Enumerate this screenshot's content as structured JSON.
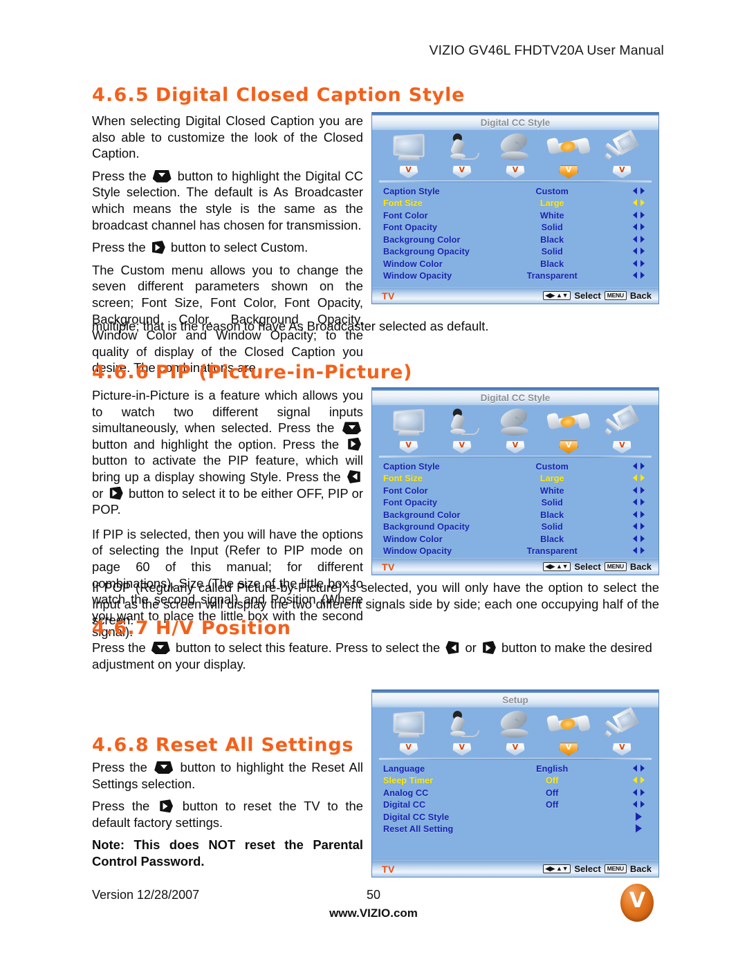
{
  "header": {
    "title": "VIZIO GV46L FHDTV20A User Manual"
  },
  "sections": [
    {
      "number": "4.6.5",
      "title": "Digital Closed Caption Style",
      "paragraphs": [
        "When selecting Digital Closed Caption you are also able to customize the look of the Closed Caption.",
        "Press the ",
        " button to highlight the Digital CC Style selection.  The default is As Broadcaster which means the style is the same as the broadcast channel has chosen for transmission.",
        "Press the ",
        " button to select Custom.",
        "The Custom menu allows you to change the seven different parameters shown on the screen; Font Size, Font Color, Font Opacity, Background Color, Background Opacity, Window Color and Window Opacity; to the quality of display of the Closed Caption you desire. The combinations are",
        "multiple; that is the reason to have As Broadcaster selected as default."
      ]
    },
    {
      "number": "4.6.6",
      "title": "PIP (Picture-in-Picture)",
      "paragraphs": [
        "Picture-in-Picture is a feature which allows you to watch two different signal inputs simultaneously, when selected. Press the ",
        " button and highlight the option. Press the ",
        " button to activate the PIP feature, which will bring up a display showing Style. Press the ",
        " or ",
        " button to select it to be either OFF, PIP or POP.",
        "If PIP is selected, then you will have the options of selecting the Input (Refer to PIP mode on page 60 of this manual; for different combinations), Size (The size of the little box to watch the second signal) and Position (Where you want to place the little box with the second signal).",
        "If POP (Regularly called Picture-by-Picture) is selected, you will only have the option to select the Input as the screen will display the two different signals side by side; each one occupying half of the screen."
      ]
    },
    {
      "number": "4.6.7",
      "title": "H/V Position",
      "paragraphs": [
        "Press the ",
        " button to select this feature. Press to select the ",
        " or ",
        " button to make the desired adjustment on your display."
      ]
    },
    {
      "number": "4.6.8",
      "title": "Reset All Settings",
      "paragraphs": [
        "Press the ",
        " button to highlight the Reset All Settings selection.",
        "Press the ",
        " button to reset the TV to the default factory settings.",
        "Note: This does NOT reset the Parental Control Password."
      ]
    }
  ],
  "osd_panels": [
    {
      "title": "Digital CC Style",
      "active_icon_index": 3,
      "icons": [
        "monitor-icon",
        "microphone-icon",
        "satellite-dish-icon",
        "wrench-icon",
        "key-icon"
      ],
      "tab_letter": "V",
      "rows": [
        {
          "label": "Caption Style",
          "value": "Custom",
          "arrow": "left-right",
          "highlighted": false
        },
        {
          "label": "Font Size",
          "value": "Large",
          "arrow": "left-right",
          "highlighted": true
        },
        {
          "label": "Font Color",
          "value": "White",
          "arrow": "left-right",
          "highlighted": false
        },
        {
          "label": "Font Opacity",
          "value": "Solid",
          "arrow": "left-right",
          "highlighted": false
        },
        {
          "label": "Backgroung Color",
          "value": "Black",
          "arrow": "left-right",
          "highlighted": false
        },
        {
          "label": "Backgroung Opacity",
          "value": "Solid",
          "arrow": "left-right",
          "highlighted": false
        },
        {
          "label": "Window Color",
          "value": "Black",
          "arrow": "left-right",
          "highlighted": false
        },
        {
          "label": "Window Opacity",
          "value": "Transparent",
          "arrow": "left-right",
          "highlighted": false
        }
      ],
      "footer": {
        "source": "TV",
        "select_label": "Select",
        "menu_key": "MENU",
        "back_label": "Back"
      }
    },
    {
      "title": "Digital CC Style",
      "active_icon_index": 3,
      "icons": [
        "monitor-icon",
        "microphone-icon",
        "satellite-dish-icon",
        "wrench-icon",
        "key-icon"
      ],
      "tab_letter": "V",
      "rows": [
        {
          "label": "Caption Style",
          "value": "Custom",
          "arrow": "left-right",
          "highlighted": false
        },
        {
          "label": "Font Size",
          "value": "Large",
          "arrow": "left-right",
          "highlighted": true
        },
        {
          "label": "Font Color",
          "value": "White",
          "arrow": "left-right",
          "highlighted": false
        },
        {
          "label": "Font Opacity",
          "value": "Solid",
          "arrow": "left-right",
          "highlighted": false
        },
        {
          "label": "Background Color",
          "value": "Black",
          "arrow": "left-right",
          "highlighted": false
        },
        {
          "label": "Background Opacity",
          "value": "Solid",
          "arrow": "left-right",
          "highlighted": false
        },
        {
          "label": "Window Color",
          "value": "Black",
          "arrow": "left-right",
          "highlighted": false
        },
        {
          "label": "Window Opacity",
          "value": "Transparent",
          "arrow": "left-right",
          "highlighted": false
        }
      ],
      "footer": {
        "source": "TV",
        "select_label": "Select",
        "menu_key": "MENU",
        "back_label": "Back"
      }
    },
    {
      "title": "Setup",
      "active_icon_index": 3,
      "icons": [
        "monitor-icon",
        "microphone-icon",
        "satellite-dish-icon",
        "wrench-icon",
        "key-icon"
      ],
      "tab_letter": "V",
      "rows": [
        {
          "label": "Language",
          "value": "English",
          "arrow": "left-right",
          "highlighted": false
        },
        {
          "label": "Sleep Timer",
          "value": "Off",
          "arrow": "left-right",
          "highlighted": true
        },
        {
          "label": "Analog CC",
          "value": "Off",
          "arrow": "left-right",
          "highlighted": false
        },
        {
          "label": "Digital  CC",
          "value": "Off",
          "arrow": "left-right",
          "highlighted": false
        },
        {
          "label": "Digital  CC  Style",
          "value": "",
          "arrow": "right",
          "highlighted": false
        },
        {
          "label": "Reset  All  Setting",
          "value": "",
          "arrow": "right",
          "highlighted": false
        }
      ],
      "footer": {
        "source": "TV",
        "select_label": "Select",
        "menu_key": "MENU",
        "back_label": "Back"
      }
    }
  ],
  "footer": {
    "version": "Version 12/28/2007",
    "page_number": "50",
    "website": "www.VIZIO.com",
    "logo_letter": "V"
  },
  "colors": {
    "heading_orange": "#F4601A",
    "osd_background": "#85B0E2",
    "osd_label_blue": "#1824AD",
    "osd_highlight_yellow": "#FFE800",
    "osd_tv_orange": "#E8500E",
    "logo_orange": "#E4771E"
  }
}
